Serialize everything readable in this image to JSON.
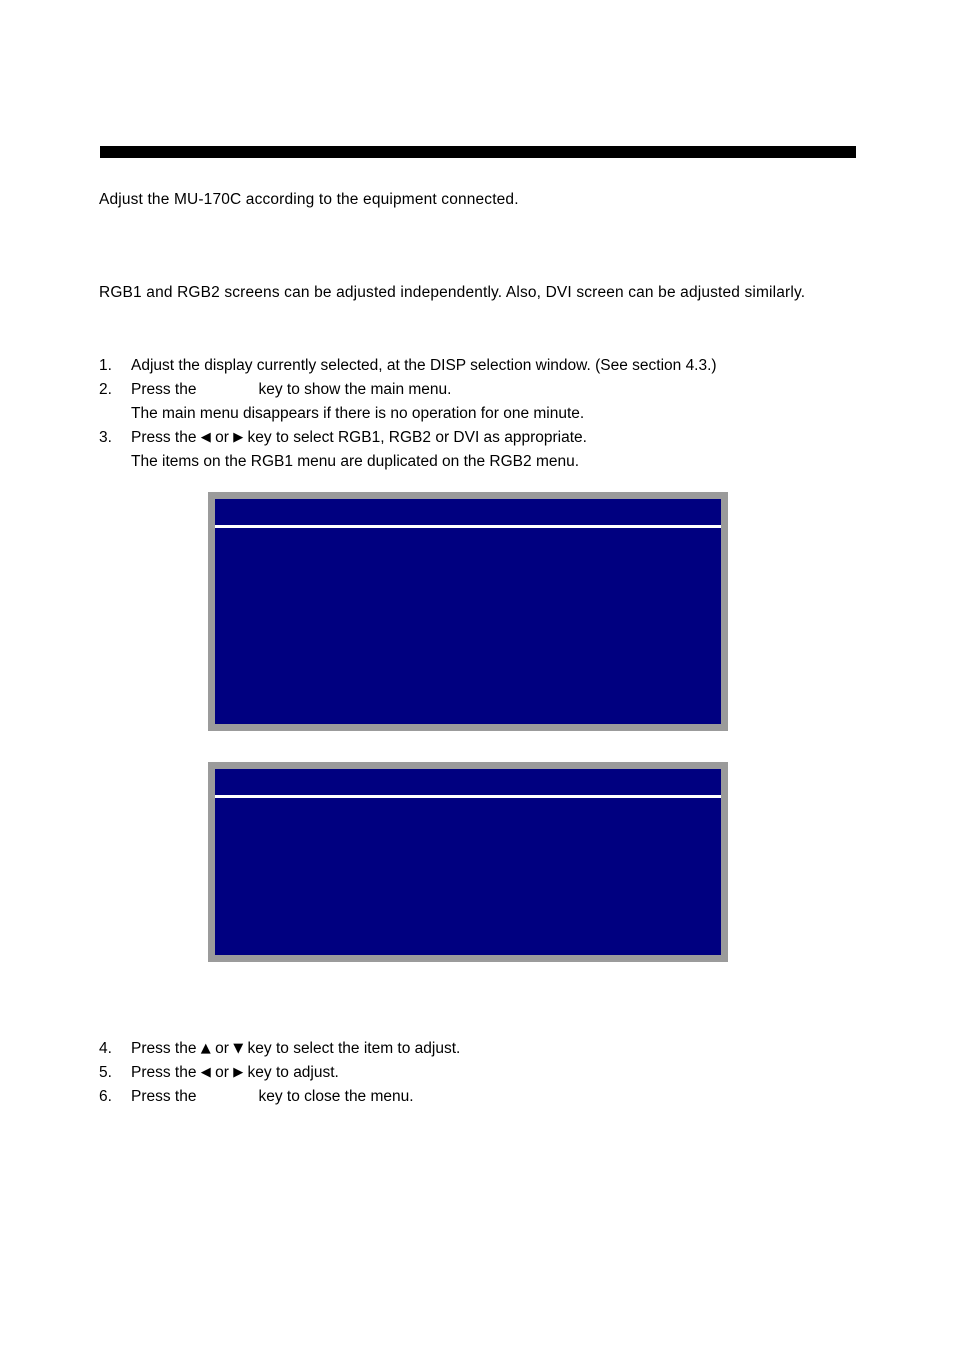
{
  "document": {
    "intro_line": "Adjust the MU-170C according to the equipment connected.",
    "lead_paragraph": "RGB1 and RGB2 screens can be adjusted independently. Also, DVI screen can be adjusted similarly."
  },
  "steps_top": [
    {
      "number": "1.",
      "text": "Adjust the display currently selected, at the DISP selection window. (See section 4.3.)",
      "note": ""
    },
    {
      "number": "2.",
      "text_before_key": "Press the",
      "key_label": "",
      "text_after_key": "key to show the main menu.",
      "note": "The main menu disappears if there is no operation for one minute."
    },
    {
      "number": "3.",
      "text_before_left": "Press the",
      "left_arrow": "◀",
      "or_word": "or",
      "right_arrow": "▶",
      "text_after": "key to select RGB1, RGB2 or DVI as appropriate.",
      "note": "The items on the RGB1 menu are duplicated on the RGB2 menu."
    }
  ],
  "steps_bottom": [
    {
      "number": "4.",
      "text_before": "Press the",
      "arrow_a": "▲",
      "or_word": "or",
      "arrow_b": "▼",
      "text_after": "key to select the item to adjust."
    },
    {
      "number": "5.",
      "text_before": "Press the",
      "arrow_a": "◀",
      "or_word": "or",
      "arrow_b": "▶",
      "text_after": "key to adjust."
    },
    {
      "number": "6.",
      "text_before_key": "Press the",
      "key_label": "",
      "text_after_key": "key to close the menu."
    }
  ],
  "figures": [
    {
      "id": "osd-menu-rgb1",
      "caption": "",
      "title_text": "",
      "body_text": "",
      "colors": {
        "screen": "#000080",
        "border": "#9b9b9b",
        "divider": "#ffffff"
      }
    },
    {
      "id": "osd-menu-rgb2",
      "caption": "",
      "title_text": "",
      "body_text": "",
      "colors": {
        "screen": "#000080",
        "border": "#9b9b9b",
        "divider": "#ffffff"
      }
    }
  ]
}
